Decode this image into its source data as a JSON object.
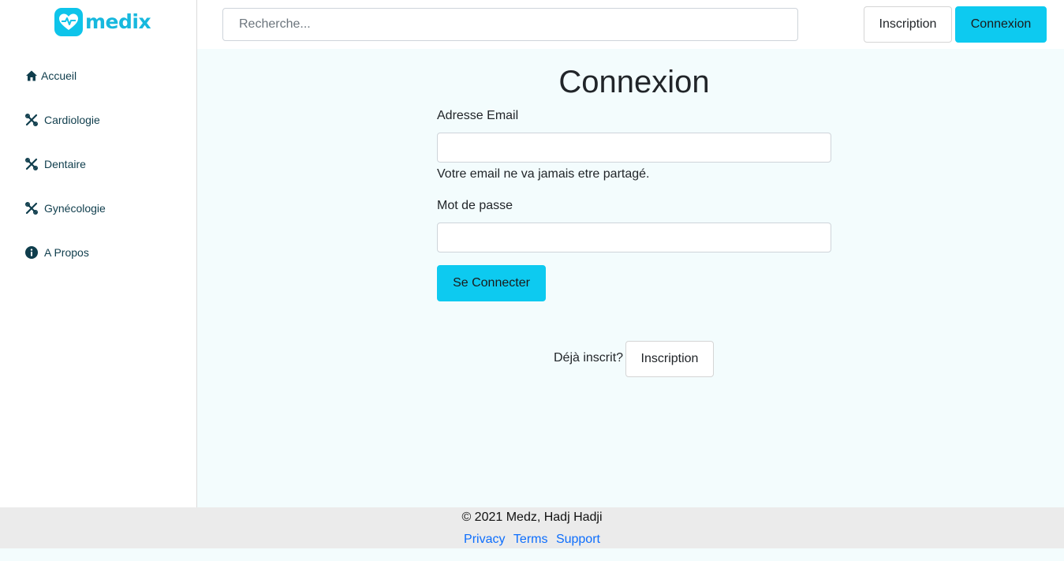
{
  "brand": {
    "name": "medix",
    "color": "#17b8de"
  },
  "sidebar": {
    "items": [
      {
        "label": "Accueil",
        "icon": "home-icon"
      },
      {
        "label": "Cardiologie",
        "icon": "tools-icon"
      },
      {
        "label": "Dentaire",
        "icon": "tools-icon"
      },
      {
        "label": "Gynécologie",
        "icon": "tools-icon"
      },
      {
        "label": "A Propos",
        "icon": "info-icon"
      }
    ]
  },
  "header": {
    "search_placeholder": "Recherche...",
    "inscription_label": "Inscription",
    "connexion_label": "Connexion"
  },
  "login": {
    "title": "Connexion",
    "email_label": "Adresse Email",
    "email_value": "",
    "email_help": "Votre email ne va jamais etre partagé.",
    "password_label": "Mot de passe",
    "password_value": "",
    "submit_label": "Se Connecter",
    "already_text": "Déjà inscrit?",
    "inscription_label": "Inscription"
  },
  "footer": {
    "copyright": "© 2021 Medz, Hadj Hadji",
    "links": [
      "Privacy",
      "Terms",
      "Support"
    ]
  },
  "colors": {
    "accent": "#0dcaf0",
    "link": "#0d6efd",
    "background": "#f3fcfd"
  }
}
